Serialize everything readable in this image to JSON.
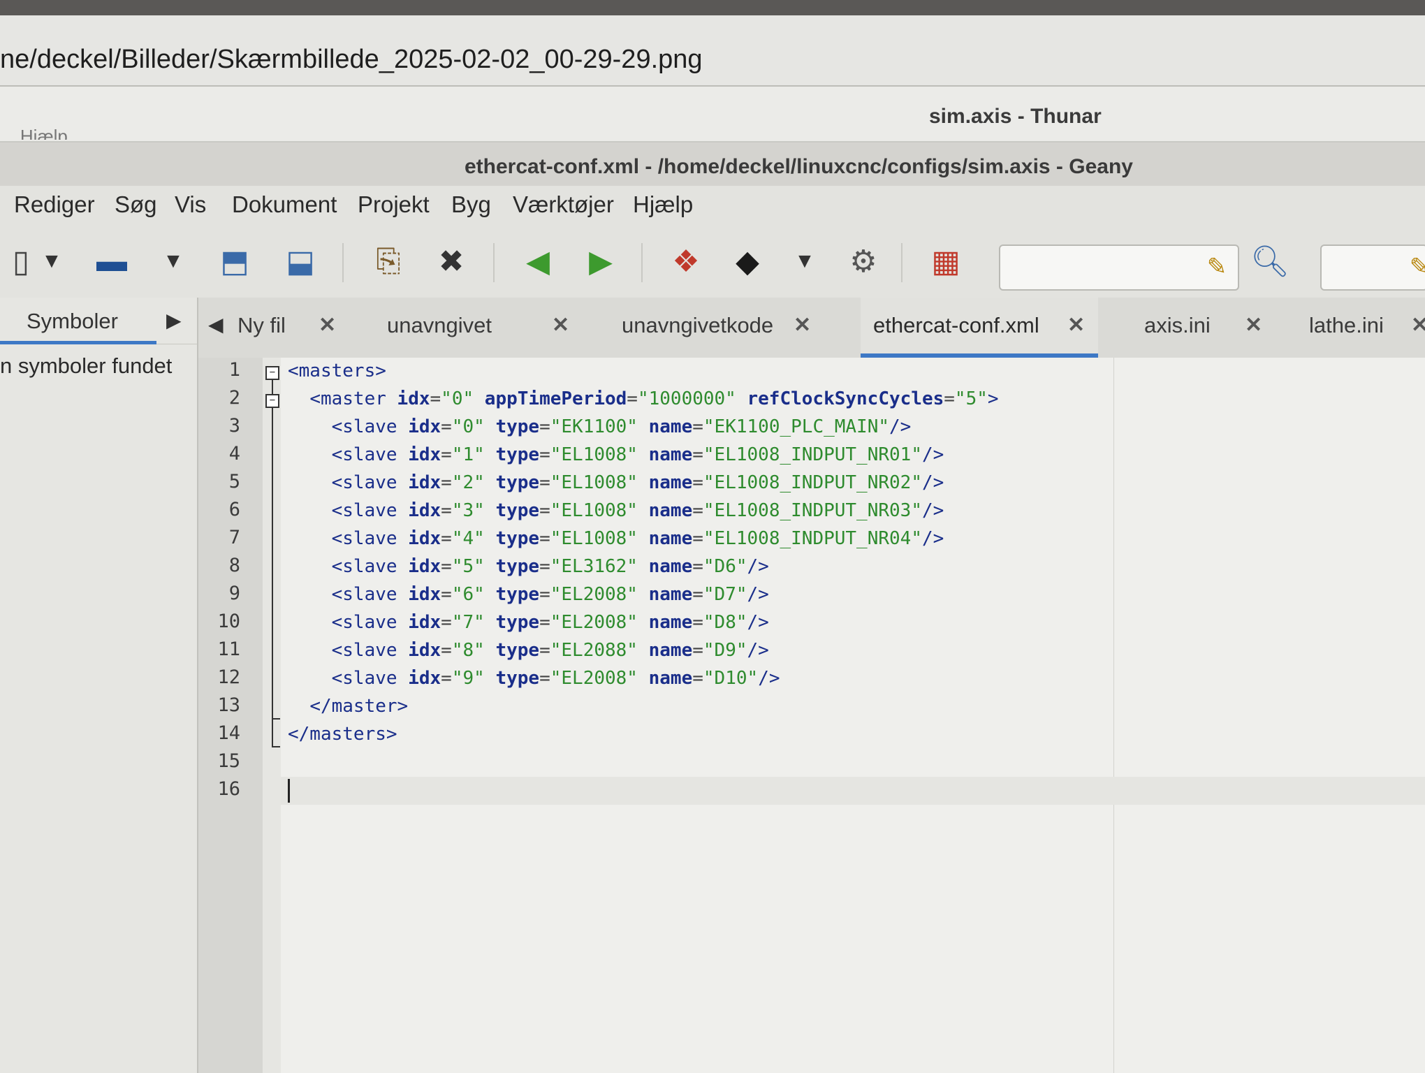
{
  "image_viewer": {
    "path": "ne/deckel/Billeder/Skærmbillede_2025-02-02_00-29-29.png"
  },
  "thunar": {
    "title": "sim.axis - Thunar",
    "menu_partial": "... Hjælp"
  },
  "geany": {
    "title": "ethercat-conf.xml - /home/deckel/linuxcnc/configs/sim.axis - Geany",
    "menu": [
      "Rediger",
      "Søg",
      "Vis",
      "Dokument",
      "Projekt",
      "Byg",
      "Værktøjer",
      "Hjælp"
    ],
    "toolbar_icons": [
      "new-icon",
      "dropdown-icon",
      "open-icon",
      "dropdown-icon",
      "save-icon",
      "save-all-icon",
      "revert-icon",
      "close-icon",
      "back-icon",
      "forward-icon",
      "compile-icon",
      "build-icon",
      "dropdown-icon",
      "execute-icon",
      "color-chooser-icon",
      "clear-icon",
      "find-icon",
      "clear-icon"
    ],
    "sidebar": {
      "tab_label": "Symboler",
      "message": "n symboler fundet"
    },
    "tabs": [
      {
        "label": "Ny fil",
        "active": false
      },
      {
        "label": "unavngivet",
        "active": false
      },
      {
        "label": "unavngivetkode",
        "active": false
      },
      {
        "label": "ethercat-conf.xml",
        "active": true
      },
      {
        "label": "axis.ini",
        "active": false
      },
      {
        "label": "lathe.ini",
        "active": false
      }
    ],
    "editor": {
      "lines": [
        {
          "n": "1",
          "text": "<masters>"
        },
        {
          "n": "2",
          "text": "  <master idx=\"0\" appTimePeriod=\"1000000\" refClockSyncCycles=\"5\">"
        },
        {
          "n": "3",
          "text": "    <slave idx=\"0\" type=\"EK1100\" name=\"EK1100_PLC_MAIN\"/>"
        },
        {
          "n": "4",
          "text": "    <slave idx=\"1\" type=\"EL1008\" name=\"EL1008_INDPUT_NR01\"/>"
        },
        {
          "n": "5",
          "text": "    <slave idx=\"2\" type=\"EL1008\" name=\"EL1008_INDPUT_NR02\"/>"
        },
        {
          "n": "6",
          "text": "    <slave idx=\"3\" type=\"EL1008\" name=\"EL1008_INDPUT_NR03\"/>"
        },
        {
          "n": "7",
          "text": "    <slave idx=\"4\" type=\"EL1008\" name=\"EL1008_INDPUT_NR04\"/>"
        },
        {
          "n": "8",
          "text": "    <slave idx=\"5\" type=\"EL3162\" name=\"D6\"/>"
        },
        {
          "n": "9",
          "text": "    <slave idx=\"6\" type=\"EL2008\" name=\"D7\"/>"
        },
        {
          "n": "10",
          "text": "    <slave idx=\"7\" type=\"EL2008\" name=\"D8\"/>"
        },
        {
          "n": "11",
          "text": "    <slave idx=\"8\" type=\"EL2088\" name=\"D9\"/>"
        },
        {
          "n": "12",
          "text": "    <slave idx=\"9\" type=\"EL2008\" name=\"D10\"/>"
        },
        {
          "n": "13",
          "text": "  </master>"
        },
        {
          "n": "14",
          "text": "</masters>"
        },
        {
          "n": "15",
          "text": ""
        },
        {
          "n": "16",
          "text": ""
        }
      ],
      "cursor_line": "16"
    }
  }
}
